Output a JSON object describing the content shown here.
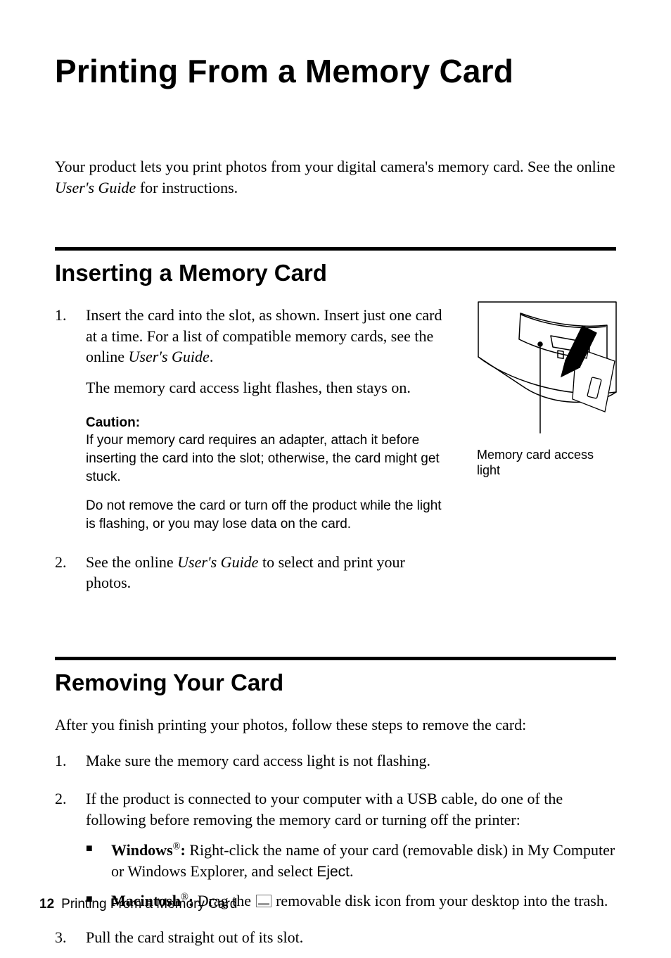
{
  "title": "Printing From a Memory Card",
  "intro": {
    "part1": "Your product lets you print photos from your digital camera's memory card. See the online ",
    "guide": "User's Guide",
    "part2": " for instructions."
  },
  "section1": {
    "heading": "Inserting a Memory Card",
    "step1_num": "1.",
    "step1a": "Insert the card into the slot, as shown. Insert just one card at a time. For a list of compatible memory cards, see the online ",
    "step1_guide": "User's Guide",
    "step1b": ".",
    "step1c": "The memory card access light flashes, then stays on.",
    "caution_label": "Caution:",
    "caution1": "If your memory card requires an adapter, attach it before inserting the card into the slot; otherwise, the card might get stuck.",
    "caution2": "Do not remove the card or turn off the product while the light is flashing, or you may lose data on the card.",
    "step2_num": "2.",
    "step2a": "See the online ",
    "step2_guide": "User's Guide",
    "step2b": " to select and print your photos.",
    "figure_caption": "Memory card access light"
  },
  "section2": {
    "heading": "Removing Your Card",
    "intro": "After you finish printing your photos, follow these steps to remove the card:",
    "step1_num": "1.",
    "step1": "Make sure the memory card access light is not flashing.",
    "step2_num": "2.",
    "step2": "If the product is connected to your computer with a USB cable, do one of the following before removing the memory card or turning off the printer:",
    "bullet1_os": "Windows",
    "bullet1_reg": "®",
    "bullet1_colon": ":",
    "bullet1_a": " Right-click the name of your card (removable disk) in My Computer or Windows Explorer, and select ",
    "bullet1_eject": "Eject",
    "bullet1_b": ".",
    "bullet2_os": "Macintosh",
    "bullet2_reg": "®",
    "bullet2_colon": ":",
    "bullet2_a": " Drag the ",
    "bullet2_b": " removable disk icon from your desktop into the trash.",
    "step3_num": "3.",
    "step3": "Pull the card straight out of its slot."
  },
  "footer": {
    "page_num": "12",
    "running": "Printing From a Memory Card"
  }
}
